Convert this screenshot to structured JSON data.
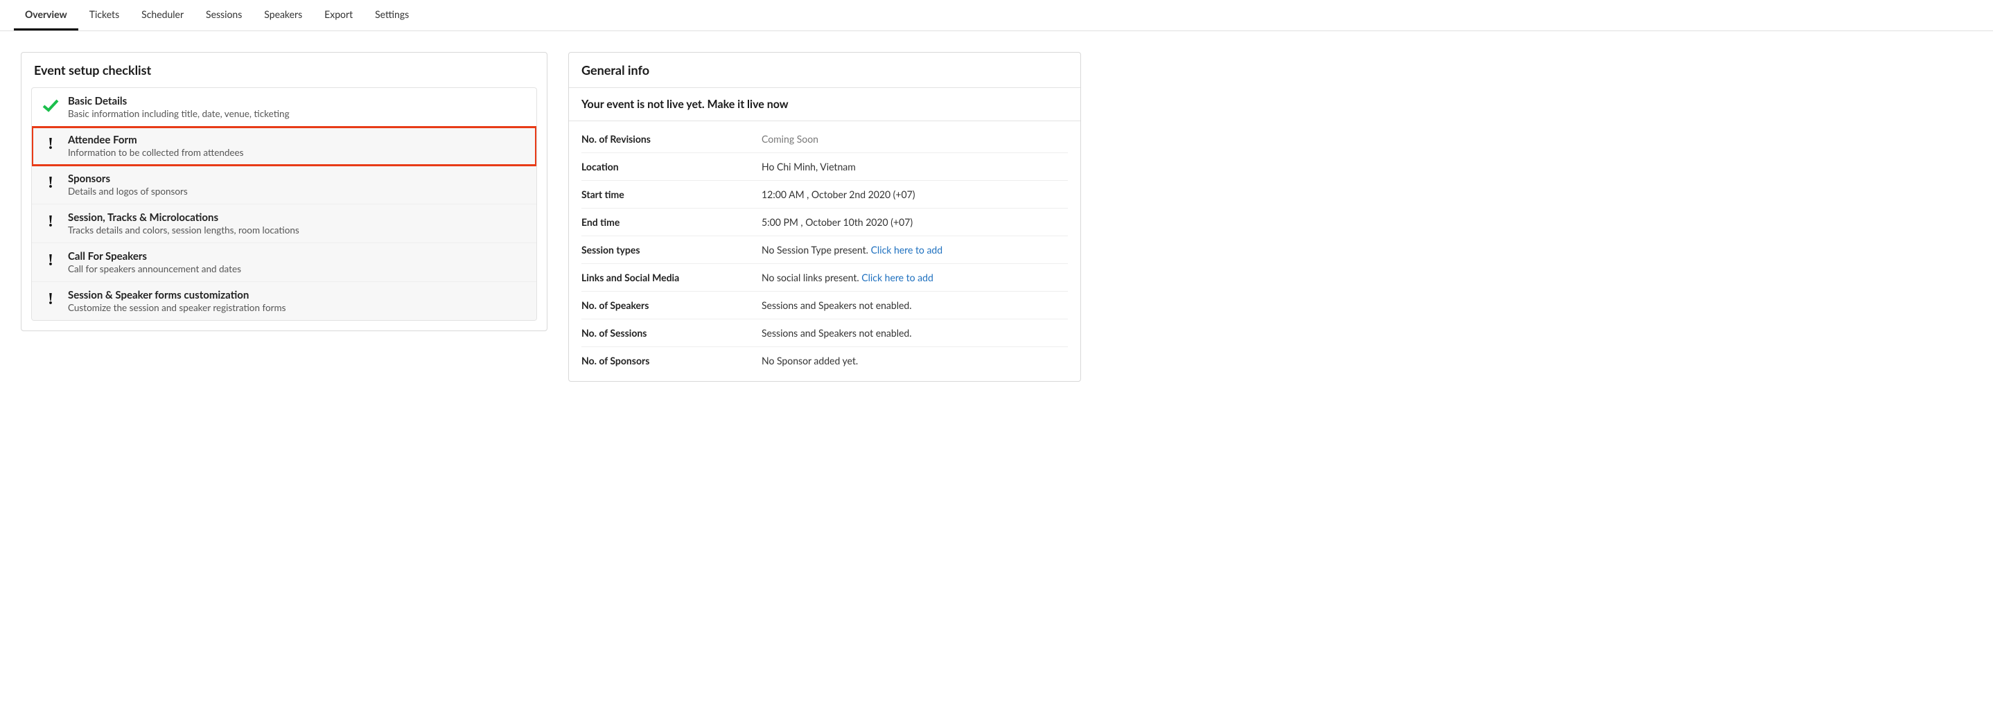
{
  "tabs": [
    {
      "label": "Overview",
      "active": true
    },
    {
      "label": "Tickets",
      "active": false
    },
    {
      "label": "Scheduler",
      "active": false
    },
    {
      "label": "Sessions",
      "active": false
    },
    {
      "label": "Speakers",
      "active": false
    },
    {
      "label": "Export",
      "active": false
    },
    {
      "label": "Settings",
      "active": false
    }
  ],
  "checklist": {
    "header": "Event setup checklist",
    "items": [
      {
        "title": "Basic Details",
        "desc": "Basic information including title, date, venue, ticketing",
        "complete": true,
        "highlighted": false
      },
      {
        "title": "Attendee Form",
        "desc": "Information to be collected from attendees",
        "complete": false,
        "highlighted": true
      },
      {
        "title": "Sponsors",
        "desc": "Details and logos of sponsors",
        "complete": false,
        "highlighted": false
      },
      {
        "title": "Session, Tracks & Microlocations",
        "desc": "Tracks details and colors, session lengths, room locations",
        "complete": false,
        "highlighted": false
      },
      {
        "title": "Call For Speakers",
        "desc": "Call for speakers announcement and dates",
        "complete": false,
        "highlighted": false
      },
      {
        "title": "Session & Speaker forms customization",
        "desc": "Customize the session and speaker registration forms",
        "complete": false,
        "highlighted": false
      }
    ]
  },
  "general": {
    "header": "General info",
    "live_msg": "Your event is not live yet. Make it live now",
    "rows": [
      {
        "label": "No. of Revisions",
        "value": "Coming Soon",
        "muted": true,
        "link": null
      },
      {
        "label": "Location",
        "value": "Ho Chi Minh, Vietnam",
        "muted": false,
        "link": null
      },
      {
        "label": "Start time",
        "value": "12:00 AM , October 2nd 2020 (+07)",
        "muted": false,
        "link": null
      },
      {
        "label": "End time",
        "value": "5:00 PM , October 10th 2020 (+07)",
        "muted": false,
        "link": null
      },
      {
        "label": "Session types",
        "value": "No Session Type present. ",
        "muted": false,
        "link": "Click here to add"
      },
      {
        "label": "Links and Social Media",
        "value": "No social links present. ",
        "muted": false,
        "link": "Click here to add"
      },
      {
        "label": "No. of Speakers",
        "value": "Sessions and Speakers not enabled.",
        "muted": false,
        "link": null
      },
      {
        "label": "No. of Sessions",
        "value": "Sessions and Speakers not enabled.",
        "muted": false,
        "link": null
      },
      {
        "label": "No. of Sponsors",
        "value": "No Sponsor added yet.",
        "muted": false,
        "link": null
      }
    ]
  }
}
